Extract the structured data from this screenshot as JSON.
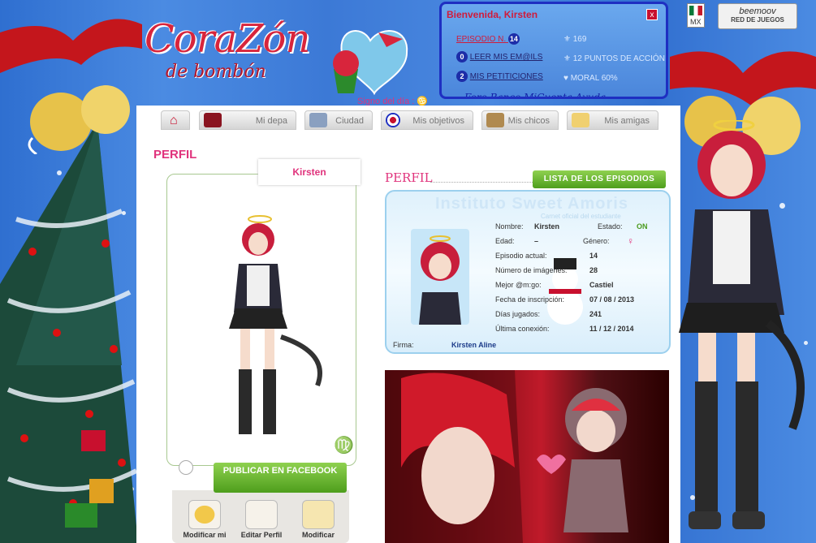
{
  "header": {
    "logo_line1": "CoraZón",
    "logo_line2": "de bombón",
    "sign_label": "Signo del día :",
    "sign_symbol": "♋"
  },
  "infobox": {
    "welcome": "Bienvenida, Kirsten",
    "close": "x",
    "episode_label": "EPISODIO N.",
    "episode_num": "14",
    "messages_count": "0",
    "messages_link": "LEER MIS EM@ILS",
    "petitions_count": "2",
    "petitions_link": "MIS PETITICIONES",
    "stat_1": "169",
    "stat_2": "12 PUNTOS DE ACCIÓN",
    "stat_3": "MORAL 60%",
    "bottom_links": "Foro    Banco    MiCuenta         Ayuda"
  },
  "locale": {
    "country_code": "MX",
    "brand": "beemoov",
    "brand_sub": "RED DE JUEGOS"
  },
  "nav": {
    "home": "",
    "tabs": [
      "Mi depa",
      "Ciudad",
      "Mis objetivos",
      "Mis chicos",
      "Mis amigas"
    ]
  },
  "profile": {
    "title": "PERFIL",
    "name_tab": "Kirsten",
    "zodiac": "♍",
    "facebook_button": "PUBLICAR EN FACEBOOK",
    "actions": [
      "Modificar mi",
      "Editar Perfil",
      "Modificar"
    ]
  },
  "card": {
    "section_title": "PERFIL",
    "episodes_button": "LISTA DE LOS EPISODIOS",
    "school": "Instituto Sweet Amoris",
    "school_sub": "Carnet oficial del estudiante",
    "fields": [
      {
        "label": "Nombre:",
        "value": "Kirsten"
      },
      {
        "label": "Edad:",
        "value": "–"
      },
      {
        "label": "Episodio actual:",
        "value": "14"
      },
      {
        "label": "Número de imágenes:",
        "value": "28"
      },
      {
        "label": "Mejor @m:go:",
        "value": "Castiel"
      },
      {
        "label": "Fecha de inscripción:",
        "value": "07 / 08 / 2013"
      },
      {
        "label": "Días jugados:",
        "value": "241"
      },
      {
        "label": "Última conexión:",
        "value": "11 / 12 / 2014"
      }
    ],
    "estado_label": "Estado:",
    "estado_value": "ON",
    "genero_label": "Género:",
    "genero_value": "♀",
    "firma_label": "Firma:",
    "firma_value": "Kirsten Aline"
  },
  "colors": {
    "accent_pink": "#e0337c",
    "green_button": "#5aa824",
    "info_border": "#1e2fc2",
    "bg_blue": "#3d7bd6"
  }
}
